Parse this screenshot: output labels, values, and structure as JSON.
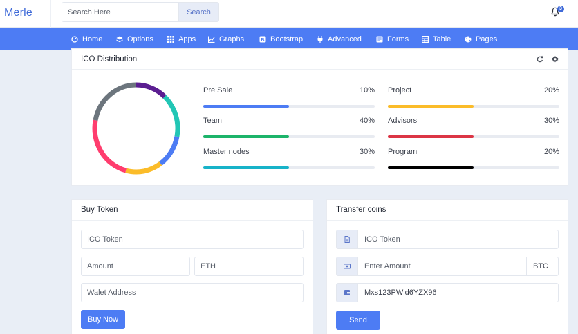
{
  "header": {
    "brand": "Merle",
    "search_placeholder": "Search Here",
    "search_button": "Search",
    "notification_count": "3"
  },
  "nav": {
    "items": [
      {
        "label": "Home",
        "icon": "dashboard-icon"
      },
      {
        "label": "Options",
        "icon": "layers-icon"
      },
      {
        "label": "Apps",
        "icon": "grid-icon"
      },
      {
        "label": "Graphs",
        "icon": "chart-icon"
      },
      {
        "label": "Bootstrap",
        "icon": "bootstrap-icon"
      },
      {
        "label": "Advanced",
        "icon": "plug-icon"
      },
      {
        "label": "Forms",
        "icon": "form-icon"
      },
      {
        "label": "Table",
        "icon": "table-icon"
      },
      {
        "label": "Pages",
        "icon": "globe-icon"
      }
    ]
  },
  "ico": {
    "title": "ICO Distribution",
    "items": [
      {
        "name": "Pre Sale",
        "percent": "10%",
        "value": 0.5,
        "color": "#4d7cf4"
      },
      {
        "name": "Project",
        "percent": "20%",
        "value": 0.5,
        "color": "#fbbc29"
      },
      {
        "name": "Team",
        "percent": "40%",
        "value": 0.5,
        "color": "#1cb46a"
      },
      {
        "name": "Advisors",
        "percent": "30%",
        "value": 0.5,
        "color": "#dc3545"
      },
      {
        "name": "Master nodes",
        "percent": "30%",
        "value": 0.5,
        "color": "#17b3c9"
      },
      {
        "name": "Program",
        "percent": "20%",
        "value": 0.5,
        "color": "#000000"
      }
    ],
    "donut_segments": [
      {
        "color": "#5b1e91",
        "value": 12
      },
      {
        "color": "#22c6b5",
        "value": 16
      },
      {
        "color": "#4d7cf4",
        "value": 12
      },
      {
        "color": "#fbbc29",
        "value": 14
      },
      {
        "color": "#ff3d6e",
        "value": 24
      },
      {
        "color": "#6c757d",
        "value": 22
      }
    ]
  },
  "buy": {
    "title": "Buy Token",
    "token_placeholder": "ICO Token",
    "amount_placeholder": "Amount",
    "currency_placeholder": "ETH",
    "wallet_placeholder": "Walet Address",
    "button": "Buy Now"
  },
  "transfer": {
    "title": "Transfer coins",
    "token_placeholder": "ICO Token",
    "amount_placeholder": "Enter Amount",
    "currency": "BTC",
    "wallet_value": "Mxs123PWid6YZX96",
    "button": "Send"
  }
}
